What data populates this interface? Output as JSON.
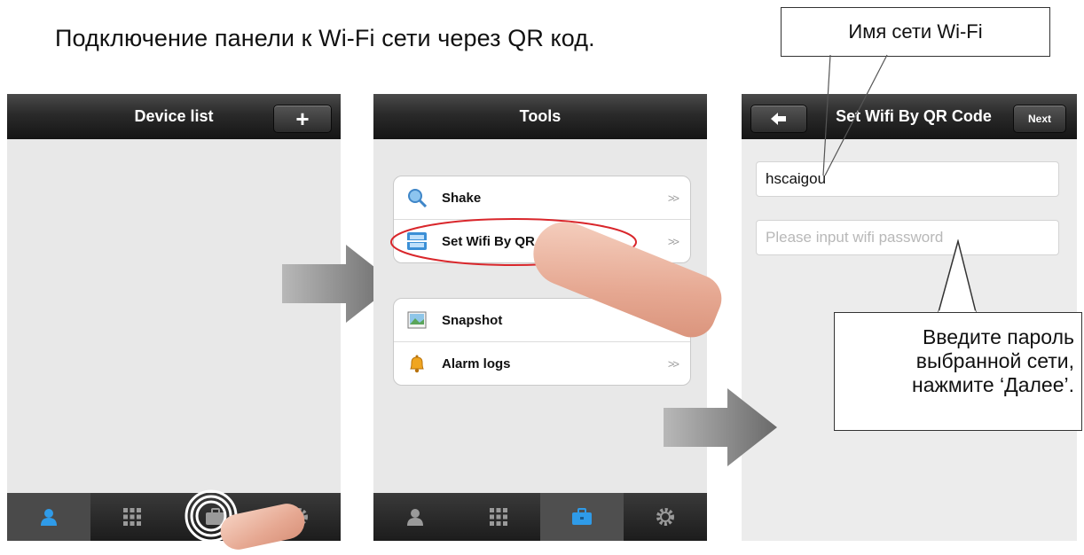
{
  "heading": "Подключение панели к Wi-Fi сети через QR код.",
  "screen1": {
    "title": "Device list",
    "add_label": "+",
    "tabs": [
      {
        "icon": "person-icon"
      },
      {
        "icon": "grid-icon"
      },
      {
        "icon": "toolbox-icon"
      },
      {
        "icon": "gear-icon"
      }
    ]
  },
  "screen2": {
    "title": "Tools",
    "group1": [
      {
        "label": "Shake",
        "chevron": ">>",
        "icon": "magnifier-icon"
      },
      {
        "label": "Set Wifi By QR Code",
        "chevron": ">>",
        "icon": "qr-scan-icon"
      }
    ],
    "group2": [
      {
        "label": "Snapshot",
        "chevron": ">>",
        "icon": "picture-icon"
      },
      {
        "label": "Alarm logs",
        "chevron": ">>",
        "icon": "bell-icon"
      }
    ]
  },
  "screen3": {
    "title": "Set Wifi By QR Code",
    "back_label": "↰",
    "next_label": "Next",
    "ssid_value": "hscaigou",
    "password_placeholder": "Please input wifi password"
  },
  "callouts": {
    "network_name": "Имя сети Wi-Fi",
    "password_hint_1": "Введите пароль",
    "password_hint_2": "выбранной сети,",
    "password_hint_3": "нажмите ‘Далее’."
  },
  "colors": {
    "accent": "#2f9be8",
    "highlight_ellipse": "#d9262b",
    "navbar": "#1c1c1c"
  }
}
